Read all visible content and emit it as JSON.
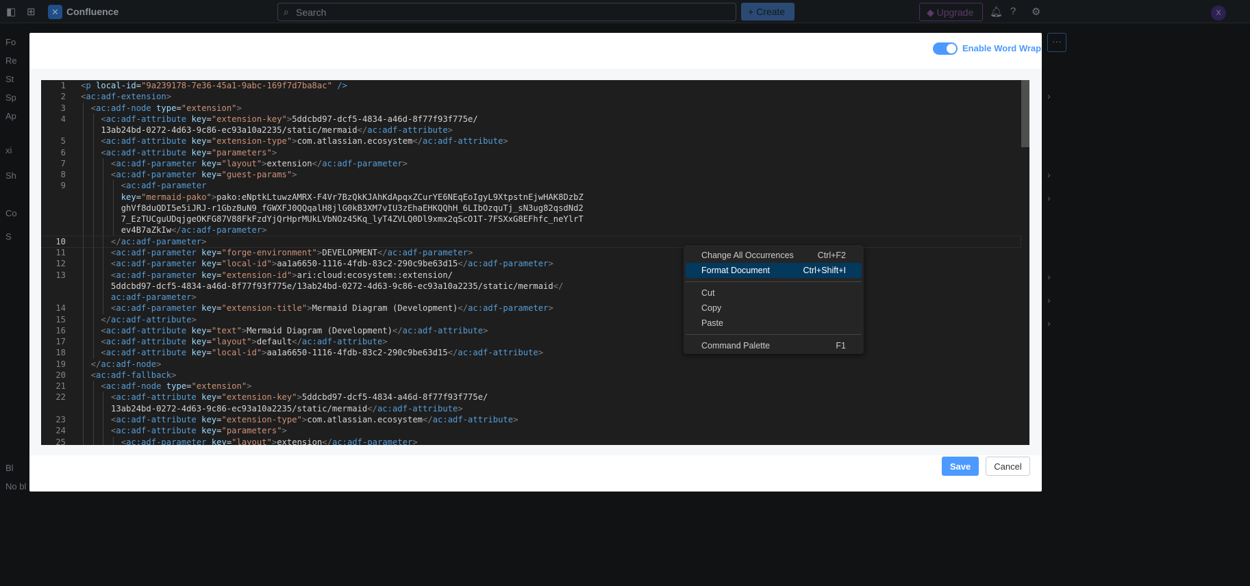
{
  "topbar": {
    "brand": "Confluence",
    "search_placeholder": "Search",
    "create_label": "+ Create",
    "upgrade_label": "Upgrade",
    "avatar_initial": "X"
  },
  "sidebar_fragments": [
    "Fo",
    "Re",
    "St",
    "Sp",
    "Ap",
    "xi",
    "Sh",
    "Co",
    "S",
    "Bl",
    "No bl"
  ],
  "modal": {
    "word_wrap_label": "Enable Word Wrap",
    "word_wrap_enabled": true,
    "save_label": "Save",
    "cancel_label": "Cancel"
  },
  "editor": {
    "current_line": "10",
    "rows": [
      {
        "n": "1",
        "i": 0,
        "t": "<p local-id=\"9a239178-7e36-45a1-9abc-169f7d7ba8ac\" />"
      },
      {
        "n": "2",
        "i": 0,
        "t": "<ac:adf-extension>"
      },
      {
        "n": "3",
        "i": 1,
        "t": "<ac:adf-node type=\"extension\">"
      },
      {
        "n": "4",
        "i": 2,
        "t": "<ac:adf-attribute key=\"extension-key\">5ddcbd97-dcf5-4834-a46d-8f77f93f775e/"
      },
      {
        "n": "",
        "i": 2,
        "t": "13ab24bd-0272-4d63-9c86-ec93a10a2235/static/mermaid</ac:adf-attribute>"
      },
      {
        "n": "5",
        "i": 2,
        "t": "<ac:adf-attribute key=\"extension-type\">com.atlassian.ecosystem</ac:adf-attribute>"
      },
      {
        "n": "6",
        "i": 2,
        "t": "<ac:adf-attribute key=\"parameters\">"
      },
      {
        "n": "7",
        "i": 3,
        "t": "<ac:adf-parameter key=\"layout\">extension</ac:adf-parameter>"
      },
      {
        "n": "8",
        "i": 3,
        "t": "<ac:adf-parameter key=\"guest-params\">"
      },
      {
        "n": "9",
        "i": 4,
        "t": "<ac:adf-parameter"
      },
      {
        "n": "",
        "i": 4,
        "t": "key=\"mermaid-pako\">pako:eNptkLtuwzAMRX-F4Vr7BzQkKJAhKdApqxZCurYE6NEqEoIgyL9XtpstnEjwHAK8DzbZ"
      },
      {
        "n": "",
        "i": 4,
        "t": "ghVf8duQDI5e5iJRJ-r1GbzBuN9_fGWXFJ0QQqalH8jlG0kB3XM7vIU3zEhaEHKQQhH_6LIbOzquTj_sN3ug82qsdNd2"
      },
      {
        "n": "",
        "i": 4,
        "t": "7_EzTUCguUDqjgeOKFG87V88FkFzdYjQrHprMUkLVbNOz45Kq_lyT4ZVLQ0Dl9xmx2qScO1T-7FSXxG8EFhfc_neYlrT"
      },
      {
        "n": "",
        "i": 4,
        "t": "ev4B7aZkIw</ac:adf-parameter>"
      },
      {
        "n": "10",
        "i": 3,
        "t": "</ac:adf-parameter>"
      },
      {
        "n": "11",
        "i": 3,
        "t": "<ac:adf-parameter key=\"forge-environment\">DEVELOPMENT</ac:adf-parameter>"
      },
      {
        "n": "12",
        "i": 3,
        "t": "<ac:adf-parameter key=\"local-id\">aa1a6650-1116-4fdb-83c2-290c9be63d15</ac:adf-parameter>"
      },
      {
        "n": "13",
        "i": 3,
        "t": "<ac:adf-parameter key=\"extension-id\">ari:cloud:ecosystem::extension/"
      },
      {
        "n": "",
        "i": 3,
        "t": "5ddcbd97-dcf5-4834-a46d-8f77f93f775e/13ab24bd-0272-4d63-9c86-ec93a10a2235/static/mermaid</"
      },
      {
        "n": "",
        "i": 3,
        "t": "ac:adf-parameter>"
      },
      {
        "n": "14",
        "i": 3,
        "t": "<ac:adf-parameter key=\"extension-title\">Mermaid Diagram (Development)</ac:adf-parameter>"
      },
      {
        "n": "15",
        "i": 2,
        "t": "</ac:adf-attribute>"
      },
      {
        "n": "16",
        "i": 2,
        "t": "<ac:adf-attribute key=\"text\">Mermaid Diagram (Development)</ac:adf-attribute>"
      },
      {
        "n": "17",
        "i": 2,
        "t": "<ac:adf-attribute key=\"layout\">default</ac:adf-attribute>"
      },
      {
        "n": "18",
        "i": 2,
        "t": "<ac:adf-attribute key=\"local-id\">aa1a6650-1116-4fdb-83c2-290c9be63d15</ac:adf-attribute>"
      },
      {
        "n": "19",
        "i": 1,
        "t": "</ac:adf-node>"
      },
      {
        "n": "20",
        "i": 1,
        "t": "<ac:adf-fallback>"
      },
      {
        "n": "21",
        "i": 2,
        "t": "<ac:adf-node type=\"extension\">"
      },
      {
        "n": "22",
        "i": 3,
        "t": "<ac:adf-attribute key=\"extension-key\">5ddcbd97-dcf5-4834-a46d-8f77f93f775e/"
      },
      {
        "n": "",
        "i": 3,
        "t": "13ab24bd-0272-4d63-9c86-ec93a10a2235/static/mermaid</ac:adf-attribute>"
      },
      {
        "n": "23",
        "i": 3,
        "t": "<ac:adf-attribute key=\"extension-type\">com.atlassian.ecosystem</ac:adf-attribute>"
      },
      {
        "n": "24",
        "i": 3,
        "t": "<ac:adf-attribute key=\"parameters\">"
      },
      {
        "n": "25",
        "i": 4,
        "t": "<ac:adf-parameter key=\"layout\">extension</ac:adf-parameter>"
      }
    ]
  },
  "context_menu": {
    "groups": [
      [
        {
          "label": "Change All Occurrences",
          "shortcut": "Ctrl+F2"
        },
        {
          "label": "Format Document",
          "shortcut": "Ctrl+Shift+I",
          "selected": true
        }
      ],
      [
        {
          "label": "Cut",
          "shortcut": ""
        },
        {
          "label": "Copy",
          "shortcut": ""
        },
        {
          "label": "Paste",
          "shortcut": ""
        }
      ],
      [
        {
          "label": "Command Palette",
          "shortcut": "F1"
        }
      ]
    ]
  }
}
